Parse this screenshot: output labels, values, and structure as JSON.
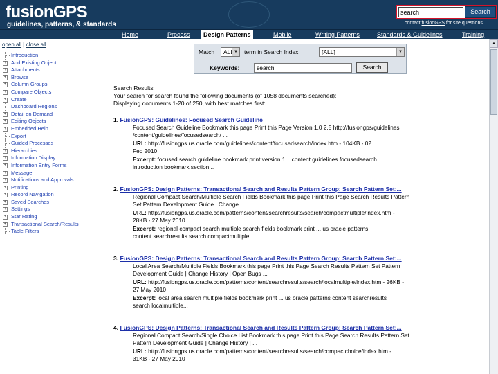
{
  "header": {
    "brand_title": "fusionGPS",
    "brand_subtitle": "guidelines, patterns, & standards",
    "search_value": "search",
    "search_button": "Search",
    "contact_prefix": "contact ",
    "contact_link": "fusionGPS",
    "contact_suffix": " for site questions"
  },
  "nav": {
    "items": [
      "Home",
      "Process",
      "Design Patterns",
      "Mobile",
      "Writing Patterns",
      "Standards & Guidelines",
      "Training"
    ],
    "active_index": 2
  },
  "sidebar": {
    "open_all": "open all",
    "separator": " | ",
    "close_all": "close all",
    "items": [
      {
        "label": "Introduction",
        "icon": "leaf"
      },
      {
        "label": "Add Existing Object",
        "icon": "plus"
      },
      {
        "label": "Attachments",
        "icon": "plus"
      },
      {
        "label": "Browse",
        "icon": "plus"
      },
      {
        "label": "Column Groups",
        "icon": "plus"
      },
      {
        "label": "Compare Objects",
        "icon": "plus"
      },
      {
        "label": "Create",
        "icon": "plus"
      },
      {
        "label": "Dashboard Regions",
        "icon": "leaf"
      },
      {
        "label": "Detail on Demand",
        "icon": "plus"
      },
      {
        "label": "Editing Objects",
        "icon": "plus"
      },
      {
        "label": "Embedded Help",
        "icon": "plus"
      },
      {
        "label": "Export",
        "icon": "leaf"
      },
      {
        "label": "Guided Processes",
        "icon": "leaf"
      },
      {
        "label": "Hierarchies",
        "icon": "plus"
      },
      {
        "label": "Information Display",
        "icon": "plus"
      },
      {
        "label": "Information Entry Forms",
        "icon": "plus"
      },
      {
        "label": "Message",
        "icon": "plus"
      },
      {
        "label": "Notifications and Approvals",
        "icon": "plus"
      },
      {
        "label": "Printing",
        "icon": "plus"
      },
      {
        "label": "Record Navigation",
        "icon": "plus"
      },
      {
        "label": "Saved Searches",
        "icon": "plus"
      },
      {
        "label": "Settings",
        "icon": "plus"
      },
      {
        "label": "Star Rating",
        "icon": "plus"
      },
      {
        "label": "Transactional Search/Results",
        "icon": "plus"
      },
      {
        "label": "Table Filters",
        "icon": "leaf"
      }
    ]
  },
  "query": {
    "match_label": "Match",
    "match_value": "ALL",
    "term_label": "term in Search Index:",
    "index_value": "[ALL]",
    "keywords_label": "Keywords:",
    "keywords_value": "search",
    "search_button": "Search"
  },
  "results": {
    "heading": "Search Results",
    "summary": "Your search for search found the following documents (of 1058 documents searched):",
    "displaying": "Displaying documents 1-20 of 250, with best matches first:",
    "items": [
      {
        "num": "1.",
        "title": "FusionGPS: Guidelines: Focused Search Guideline",
        "lines": [
          {
            "label": "",
            "text": "Focused Search Guideline Bookmark this page Print this Page Version 1.0 2.5 http://fusiongps/guidelines"
          },
          {
            "label": "",
            "text": "/content/guidelines/focusedsearch/ ..."
          },
          {
            "label": "URL:",
            "text": " http://fusiongps.us.oracle.com/guidelines/content/focusedsearch/index.htm - 104KB - 02"
          },
          {
            "label": "",
            "text": "Feb 2010"
          },
          {
            "label": "Excerpt:",
            "text": " focused search guideline bookmark print version 1... content guidelines focusedsearch"
          },
          {
            "label": "",
            "text": "introduction bookmark section..."
          }
        ]
      },
      {
        "num": "2.",
        "title": "FusionGPS: Design Patterns: Transactional Search and Results Pattern Group: Search Pattern Set:...",
        "lines": [
          {
            "label": "",
            "text": "Regional Compact Search/Multiple Search Fields Bookmark this page Print this Page Search Results Pattern"
          },
          {
            "label": "",
            "text": "Set Pattern Development Guide | Change..."
          },
          {
            "label": "URL:",
            "text": " http://fusiongps.us.oracle.com/patterns/content/searchresults/search/compactmultiple/index.htm -"
          },
          {
            "label": "",
            "text": "28KB - 27 May 2010"
          },
          {
            "label": "Excerpt:",
            "text": " regional compact search multiple search fields bookmark print ... us oracle patterns"
          },
          {
            "label": "",
            "text": "content searchresults search compactmultiple..."
          }
        ]
      },
      {
        "num": "3.",
        "title": "FusionGPS: Design Patterns: Transactional Search and Results Pattern Group: Search Pattern Set:...",
        "lines": [
          {
            "label": "",
            "text": "Local Area Search/Multiple Fields Bookmark this page Print this Page Search Results Pattern Set Pattern"
          },
          {
            "label": "",
            "text": "Development Guide | Change History | Open Bugs ..."
          },
          {
            "label": "URL:",
            "text": " http://fusiongps.us.oracle.com/patterns/content/searchresults/search/localmultiple/index.htm - 26KB -"
          },
          {
            "label": "",
            "text": "27 May 2010"
          },
          {
            "label": "Excerpt:",
            "text": " local area search multiple fields bookmark print ... us oracle patterns content searchresults"
          },
          {
            "label": "",
            "text": "search localmultiple..."
          }
        ]
      },
      {
        "num": "4.",
        "title": "FusionGPS: Design Patterns: Transactional Search and Results Pattern Group: Search Pattern Set:...",
        "lines": [
          {
            "label": "",
            "text": "Regional Compact Search/Single Choice List Bookmark this page Print this Page Search Results Pattern Set"
          },
          {
            "label": "",
            "text": "Pattern Development Guide | Change History | ..."
          },
          {
            "label": "URL:",
            "text": " http://fusiongps.us.oracle.com/patterns/content/searchresults/search/compactchoice/index.htm -"
          },
          {
            "label": "",
            "text": "31KB - 27 May 2010"
          }
        ]
      }
    ]
  },
  "colors": {
    "header_bg": "#173b5e",
    "highlight_border": "#d3142b",
    "link": "#1c2fa8"
  }
}
